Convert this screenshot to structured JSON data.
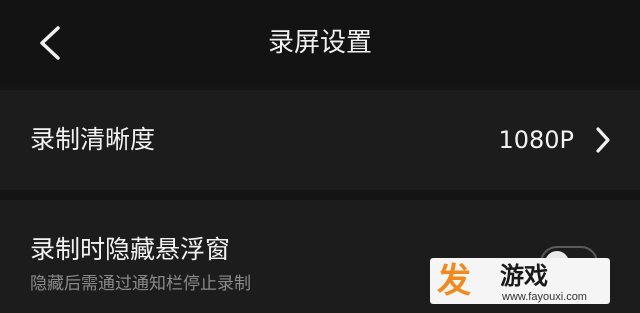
{
  "header": {
    "title": "录屏设置",
    "back_icon": "chevron-left-icon"
  },
  "settings": {
    "resolution": {
      "label": "录制清晰度",
      "value": "1080P",
      "chevron_icon": "chevron-right-icon"
    },
    "hide_float": {
      "label": "录制时隐藏悬浮窗",
      "description": "隐藏后需通过通知栏停止录制",
      "enabled": false
    }
  },
  "watermark": {
    "brand": "游戏",
    "logo_text": "发",
    "url": "www.fayouxi.com",
    "logo_color": "#f08a1c"
  },
  "colors": {
    "background": "#141414",
    "row_background": "#1c1c1c",
    "text_primary": "#f2f2f2",
    "text_secondary": "#8a8a8a"
  }
}
